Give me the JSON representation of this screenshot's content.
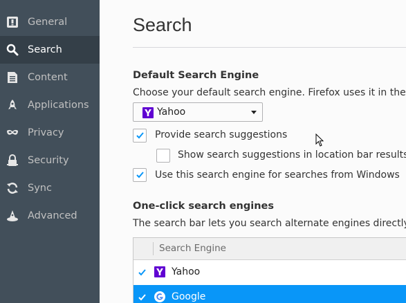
{
  "sidebar": {
    "items": [
      {
        "label": "General",
        "icon": "general-icon",
        "active": false
      },
      {
        "label": "Search",
        "icon": "search-icon",
        "active": true
      },
      {
        "label": "Content",
        "icon": "content-icon",
        "active": false
      },
      {
        "label": "Applications",
        "icon": "applications-icon",
        "active": false
      },
      {
        "label": "Privacy",
        "icon": "privacy-mask-icon",
        "active": false
      },
      {
        "label": "Security",
        "icon": "security-icon",
        "active": false
      },
      {
        "label": "Sync",
        "icon": "sync-icon",
        "active": false
      },
      {
        "label": "Advanced",
        "icon": "advanced-wizard-icon",
        "active": false
      }
    ]
  },
  "main": {
    "title": "Search",
    "default_engine": {
      "heading": "Default Search Engine",
      "description": "Choose your default search engine. Firefox uses it in the loca",
      "selected": "Yahoo"
    },
    "options": {
      "provide_suggestions": {
        "label": "Provide search suggestions",
        "checked": true
      },
      "location_bar_suggestions": {
        "label": "Show search suggestions in location bar results",
        "checked": false
      },
      "windows_search": {
        "label": "Use this search engine for searches from Windows",
        "checked": true
      }
    },
    "one_click": {
      "heading": "One-click search engines",
      "description": "The search bar lets you search alternate engines directly. Cho",
      "column_header": "Search Engine",
      "engines": [
        {
          "name": "Yahoo",
          "checked": true,
          "selected": false
        },
        {
          "name": "Google",
          "checked": true,
          "selected": true
        }
      ]
    }
  },
  "colors": {
    "sidebar_bg": "#424f5a",
    "sidebar_active": "#343f48",
    "accent": "#0996f8",
    "yahoo_purple": "#6001d2"
  }
}
